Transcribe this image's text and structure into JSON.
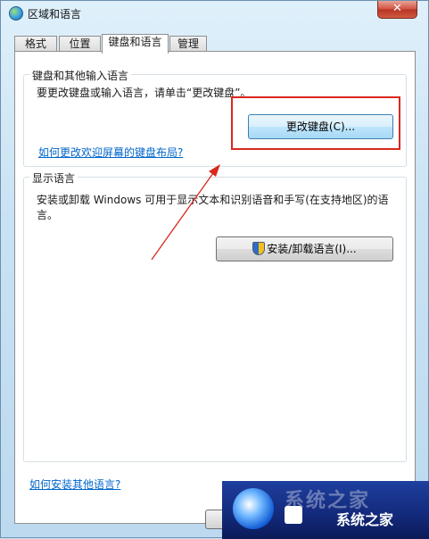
{
  "window": {
    "title": "区域和语言",
    "close_symbol": "✕"
  },
  "tabs": [
    {
      "label": "格式"
    },
    {
      "label": "位置"
    },
    {
      "label": "键盘和语言"
    },
    {
      "label": "管理"
    }
  ],
  "keyboard_group": {
    "title": "键盘和其他输入语言",
    "description": "要更改键盘或输入语言，请单击“更改键盘”。",
    "change_button": "更改键盘(C)...",
    "welcome_link": "如何更改欢迎屏幕的键盘布局?"
  },
  "display_group": {
    "title": "显示语言",
    "description_line1": "安装或卸载 Windows 可用于显示文本和识别语音和手写(在支持地区)的语",
    "description_line2": "言。",
    "install_button": "安装/卸载语言(I)..."
  },
  "footer": {
    "install_link": "如何安装其他语言?"
  },
  "watermark": {
    "text": "系统之家",
    "ghost_text": "系统之家"
  },
  "colors": {
    "annotation": "#d9281e",
    "link": "#0066cc",
    "accent": "#3c7fb1"
  }
}
